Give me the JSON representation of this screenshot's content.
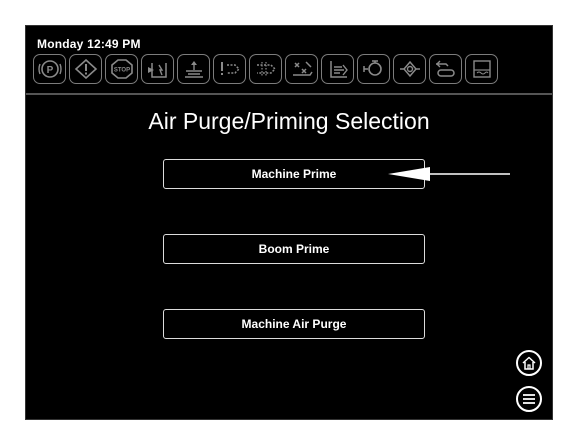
{
  "status": {
    "datetime": "Monday 12:49 PM"
  },
  "toolbar": {
    "icons": [
      "parking-brake-icon",
      "warning-icon",
      "stop-icon",
      "tank-icon",
      "boom-height-icon",
      "fault-flow-icon",
      "pump-icon",
      "spray-off-icon",
      "boom-level-icon",
      "valve-icon",
      "pressure-icon",
      "hitch-icon",
      "rinse-tank-icon"
    ]
  },
  "page": {
    "title": "Air Purge/Priming Selection"
  },
  "menu": {
    "machine_prime": "Machine Prime",
    "boom_prime": "Boom Prime",
    "machine_air_purge": "Machine Air Purge"
  },
  "nav": {
    "home": "home-icon",
    "menu": "hamburger-menu-icon"
  }
}
